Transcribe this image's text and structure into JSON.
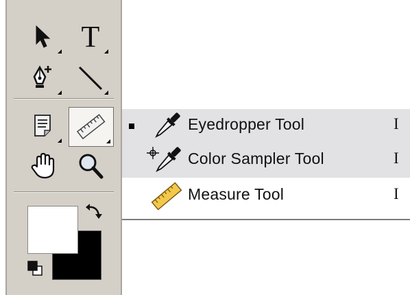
{
  "toolbox": {
    "tools": [
      {
        "icon": "move-icon",
        "has_flyout": true
      },
      {
        "icon": "type-icon",
        "label": "T",
        "has_flyout": true
      },
      {
        "icon": "pen-icon",
        "has_flyout": true
      },
      {
        "icon": "line-icon",
        "has_flyout": true
      },
      {
        "icon": "notes-icon",
        "has_flyout": true
      },
      {
        "icon": "measure-icon",
        "has_flyout": true,
        "active": true
      },
      {
        "icon": "hand-icon",
        "has_flyout": false
      },
      {
        "icon": "zoom-icon",
        "has_flyout": false
      }
    ],
    "colors": {
      "foreground": "#ffffff",
      "background": "#000000"
    }
  },
  "flyout": {
    "items": [
      {
        "label": "Eyedropper Tool",
        "shortcut": "I",
        "icon": "eyedropper-icon",
        "selected": true
      },
      {
        "label": "Color Sampler Tool",
        "shortcut": "I",
        "icon": "color-sampler-icon",
        "selected": false
      },
      {
        "label": "Measure Tool",
        "shortcut": "I",
        "icon": "ruler-icon",
        "selected": false
      }
    ]
  }
}
